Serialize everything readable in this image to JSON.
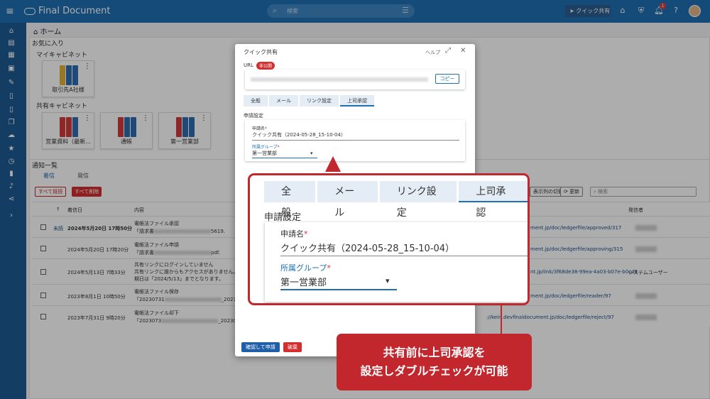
{
  "topbar": {
    "app_title": "Final Document",
    "search_placeholder": "検索",
    "quick_share_label": "クイック共有",
    "notification_count": "1"
  },
  "breadcrumb": {
    "home": "ホーム"
  },
  "favorites": {
    "label": "お気に入り",
    "my_cabinet_label": "マイキャビネット",
    "my_cabinets": [
      "取引先A社様"
    ],
    "shared_cabinet_label": "共有キャビネット",
    "shared_cabinets": [
      "営業資料（最新...",
      "通帳",
      "第一営業部"
    ]
  },
  "notifications": {
    "title": "通知一覧",
    "tabs": [
      "着信",
      "発信"
    ],
    "read_all": "すべて既読",
    "delete_all": "すべて削除",
    "column_switch": "表示列の切替",
    "refresh": "更新",
    "search_placeholder": "検索",
    "headers": {
      "received": "着信日",
      "content": "内容",
      "sender": "発信者"
    },
    "rows": [
      {
        "status": "未読",
        "date": "2024年5月20日 17時50分",
        "content1": "電帳法ファイル承認",
        "content2": "「請求書",
        "content_tail": "5619.",
        "url": "ment.jp/doc/ledgerfile/approved/317",
        "sender": ""
      },
      {
        "status": "",
        "date": "2024年5月20日 17時20分",
        "content1": "電帳法ファイル申請",
        "content2": "「請求書",
        "content_tail": "pdf.",
        "url": "ment.jp/doc/ledgerfile/approving/315",
        "sender": ""
      },
      {
        "status": "",
        "date": "2024年5月13日 7時33分",
        "content1": "共有リンクにログインしていません",
        "content2": "共有リンクに誰からもアクセスがありません。",
        "content3": "期日は「2024/5/13」までとなります。",
        "url": "nt.jp/link/3f68de38-99ea-4a03-b07e-b0cd8",
        "sender": "システムユーザー"
      },
      {
        "status": "",
        "date": "2023年8月1日 10時50分",
        "content1": "電帳法ファイル保存",
        "content2": "「20230731",
        "content_tail": "_20230",
        "url": "ment.jp/doc/ledgerfile/reader/97",
        "sender": ""
      },
      {
        "status": "",
        "date": "2023年7月31日 9時20分",
        "content1": "電帳法ファイル却下",
        "content2": "「2023073",
        "content_tail": "_20230",
        "url": "://keiri.devfinaldocument.jp/doc/ledgerfile/reject/97",
        "sender": ""
      }
    ]
  },
  "dialog": {
    "title": "クイック共有",
    "help": "ヘルプ",
    "url_label": "URL",
    "private_badge": "非公開",
    "copy_label": "コピー",
    "tabs": [
      "全般",
      "メール",
      "リンク設定",
      "上司承認"
    ],
    "section_title": "申請設定",
    "request_name_label": "申請名",
    "request_name_value": "クイック共有（2024-05-28_15-10-04）",
    "group_label": "所属グループ",
    "group_value": "第一営業部",
    "confirm_button": "確認して申請",
    "discard_button": "破棄"
  },
  "zoom": {
    "tabs": [
      "全般",
      "メール",
      "リンク設定",
      "上司承認"
    ],
    "section_title": "申請設定",
    "request_name_label": "申請名",
    "request_name_value": "クイック共有（2024-05-28_15-10-04）",
    "group_label": "所属グループ",
    "group_value": "第一営業部"
  },
  "callout": {
    "line1": "共有前に上司承認を",
    "line2": "設定しダブルチェックが可能"
  },
  "colors": {
    "primary": "#1f6fb2",
    "accent_red": "#c1272d",
    "nav": "#1e5a92"
  }
}
